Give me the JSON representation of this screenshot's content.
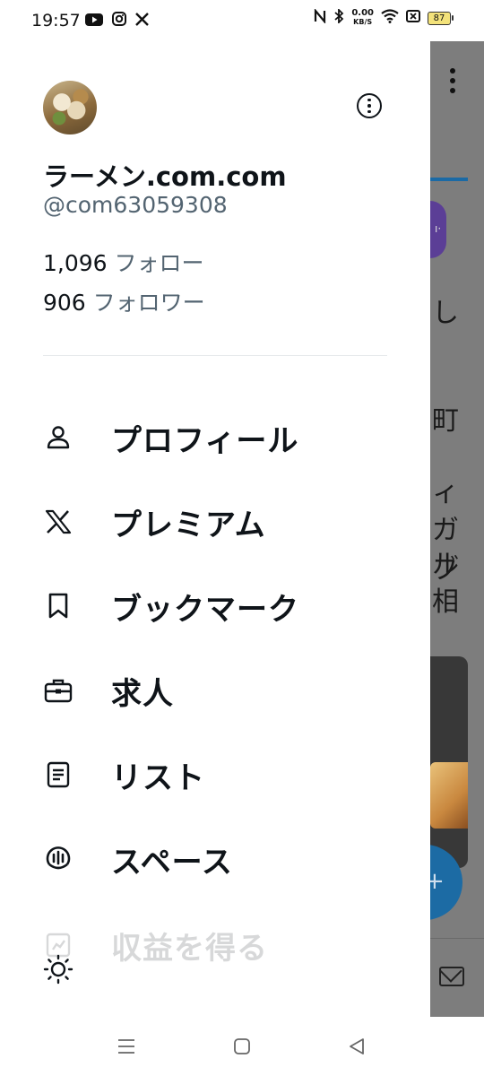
{
  "status_bar": {
    "time": "19:57",
    "left_icons": [
      "youtube-icon",
      "instagram-icon",
      "x-icon"
    ],
    "net_speed_value": "0.00",
    "net_speed_unit": "KB/S",
    "battery": "87"
  },
  "profile": {
    "display_name": "ラーメン.com.com",
    "handle": "@com63059308",
    "following_count": "1,096",
    "following_label": "フォロー",
    "followers_count": "906",
    "followers_label": "フォロワー"
  },
  "menu": {
    "items": [
      {
        "label": "プロフィール",
        "icon": "person-icon"
      },
      {
        "label": "プレミアム",
        "icon": "x-logo-icon"
      },
      {
        "label": "ブックマーク",
        "icon": "bookmark-icon"
      },
      {
        "label": "求人",
        "icon": "briefcase-icon"
      },
      {
        "label": "リスト",
        "icon": "list-icon"
      },
      {
        "label": "スペース",
        "icon": "spaces-icon"
      },
      {
        "label": "収益を得る",
        "icon": "monetize-icon"
      }
    ]
  },
  "background_peek": {
    "texts": [
      "し",
      "町",
      "ィ",
      "ガブ",
      "ル",
      "相"
    ]
  },
  "colors": {
    "text_primary": "#0f1419",
    "text_secondary": "#536471",
    "scrim": "#7d7d7d",
    "accent": "#1d9bf0"
  }
}
